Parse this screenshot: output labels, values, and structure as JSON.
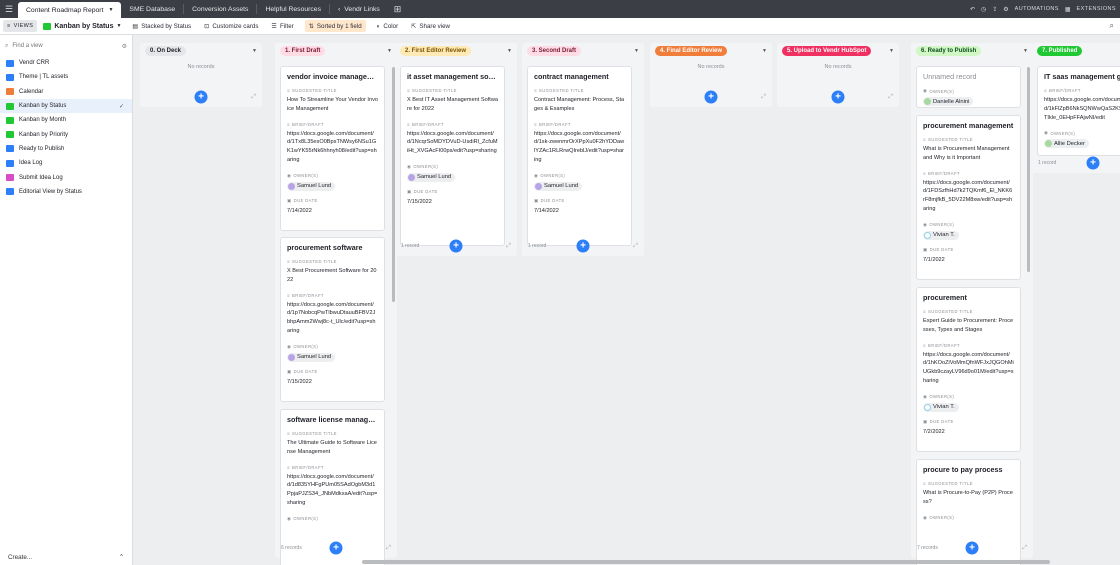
{
  "topbar": {
    "tabs": [
      {
        "label": "Content Roadmap Report"
      },
      {
        "label": "SME Database"
      },
      {
        "label": "Conversion Assets"
      },
      {
        "label": "Helpful Resources"
      },
      {
        "label": "Vendr Links"
      }
    ],
    "automations": "AUTOMATIONS",
    "extensions": "EXTENSIONS"
  },
  "toolbar": {
    "views_label": "VIEWS",
    "view_name": "Kanban by Status",
    "stacked": "Stacked by Status",
    "customize": "Customize cards",
    "filter": "Filter",
    "sorted": "Sorted by 1 field",
    "color": "Color",
    "share": "Share view"
  },
  "sidebar": {
    "find_placeholder": "Find a view",
    "create": "Create...",
    "items": [
      {
        "label": "Vendr CRR",
        "color": "#2d7ff9"
      },
      {
        "label": "Theme | TL assets",
        "color": "#2d7ff9"
      },
      {
        "label": "Calendar",
        "color": "#f07d3a"
      },
      {
        "label": "Kanban by Status",
        "color": "#20c933"
      },
      {
        "label": "Kanban by Month",
        "color": "#20c933"
      },
      {
        "label": "Kanban by Priority",
        "color": "#20c933"
      },
      {
        "label": "Ready to Publish",
        "color": "#2d7ff9"
      },
      {
        "label": "Idea Log",
        "color": "#2d7ff9"
      },
      {
        "label": "Submit Idea Log",
        "color": "#d84cc8"
      },
      {
        "label": "Editorial View by Status",
        "color": "#2d7ff9"
      }
    ]
  },
  "labels": {
    "suggested": "SUGGESTED TITLE",
    "brief": "BRIEF/DRAFT",
    "owner": "OWNER(S)",
    "due": "DUE DATE",
    "no_records": "No records"
  },
  "columns": [
    {
      "name": "0. On Deck",
      "color": "#e4e6ea",
      "text_color": "#1d1f25",
      "footer": "",
      "cards": []
    },
    {
      "name": "1. First Draft",
      "color": "#ffdce5",
      "text_color": "#7a1733",
      "footer": "6 records",
      "cards": [
        {
          "title": "vendor invoice manageme...",
          "suggested": "How To Streamline Your Vendor Invoice Management",
          "brief": "https://docs.google.com/document/d/1Tx8L35esO0BpsTNWsy6NSu1GK1wYK55rNk6hhnyh08/edit?usp=sharing",
          "owner": "Samuel Lund",
          "due": "7/14/2022"
        },
        {
          "title": "procurement software",
          "suggested": "X Best Procurement Software for 2022",
          "brief": "https://docs.google.com/document/d/1p7NobcqPwTlbwuDtauuBFBV2JbhpAmm2Wwj8c-t_Ulc/edit?usp=sharing",
          "owner": "Samuel Lund",
          "due": "7/15/2022"
        },
        {
          "title": "software license manage...",
          "suggested": "The Ultimate Guide to Software License Management",
          "brief": "https://docs.google.com/document/d/1d835YHFgPUm05SAdOgbM3d1PpjaPJZS34_JNbMdkxaA/edit?usp=sharing",
          "owner": "",
          "due": ""
        }
      ]
    },
    {
      "name": "2. First Editor Review",
      "color": "#ffeab6",
      "text_color": "#7a5300",
      "footer": "1 record",
      "cards": [
        {
          "title": "it asset management soft...",
          "suggested": "X Best IT Asset Management Software for 2022",
          "brief": "https://docs.google.com/document/d/1NcqrSoMDYDVuD-UsdiRl_ZcfuMiHt_XVGAcFI00ps/edit?usp=sharing",
          "owner": "Samuel Lund",
          "due": "7/15/2022"
        }
      ]
    },
    {
      "name": "3. Second Draft",
      "color": "#ffdce5",
      "text_color": "#7a1733",
      "footer": "1 record",
      "cards": [
        {
          "title": "contract management",
          "suggested": "Contract Management: Process, Stages & Examples",
          "brief": "https://docs.google.com/document/d/1sk-zwenmrOrXPpXu0F2hYDDawlYZAc1RLRrwQIreblJ/edit?usp=sharing",
          "owner": "Samuel Lund",
          "due": "7/14/2022"
        }
      ]
    },
    {
      "name": "4. Final Editor Review",
      "color": "#f07d3a",
      "text_color": "#ffffff",
      "footer": "",
      "cards": []
    },
    {
      "name": "5. Upload to Vendr HubSpot",
      "color": "#ef3061",
      "text_color": "#ffffff",
      "footer": "",
      "cards": []
    },
    {
      "name": "6. Ready to Publish",
      "color": "#d1f7c4",
      "text_color": "#0b4f1e",
      "footer": "7 records",
      "cards": [
        {
          "title": "Unnamed record",
          "suggested": "",
          "brief": "",
          "owner": "Danielle Alnini",
          "due": ""
        },
        {
          "title": "procurement management",
          "suggested": "What is Procurement Management and Why is it Important",
          "brief": "https://docs.google.com/document/d/1FDSzfhHd7k2TQKmf6_El_NKK6rF8mjfkB_5DV22M8xw/edit?usp=sharing",
          "owner": "Vivian T.",
          "due": "7/1/2022"
        },
        {
          "title": "procurement",
          "suggested": "Expert Guide to Procurement: Processes, Types and Stages",
          "brief": "https://docs.google.com/document/d/1hKOoZiVoMmQfnWFJxJQGOhMiUGkb9czayLV96d9o01M/edit?usp=sharing",
          "owner": "Vivian T.",
          "due": "7/2/2022"
        },
        {
          "title": "procure to pay process",
          "suggested": "What is Procure-to-Pay (P2P) Process?",
          "brief": "",
          "owner": "",
          "due": ""
        }
      ]
    },
    {
      "name": "7. Published",
      "color": "#20c933",
      "text_color": "#ffffff",
      "footer": "1 record",
      "cards": [
        {
          "title": "IT saas management gu...",
          "suggested": "",
          "brief": "https://docs.google.com/document/d/1kFlZpB6NkSQNWwQaS2KSkSoTIkle_0EHpFFAjwNI/edit",
          "owner": "Allie Decker",
          "due": ""
        }
      ]
    }
  ]
}
